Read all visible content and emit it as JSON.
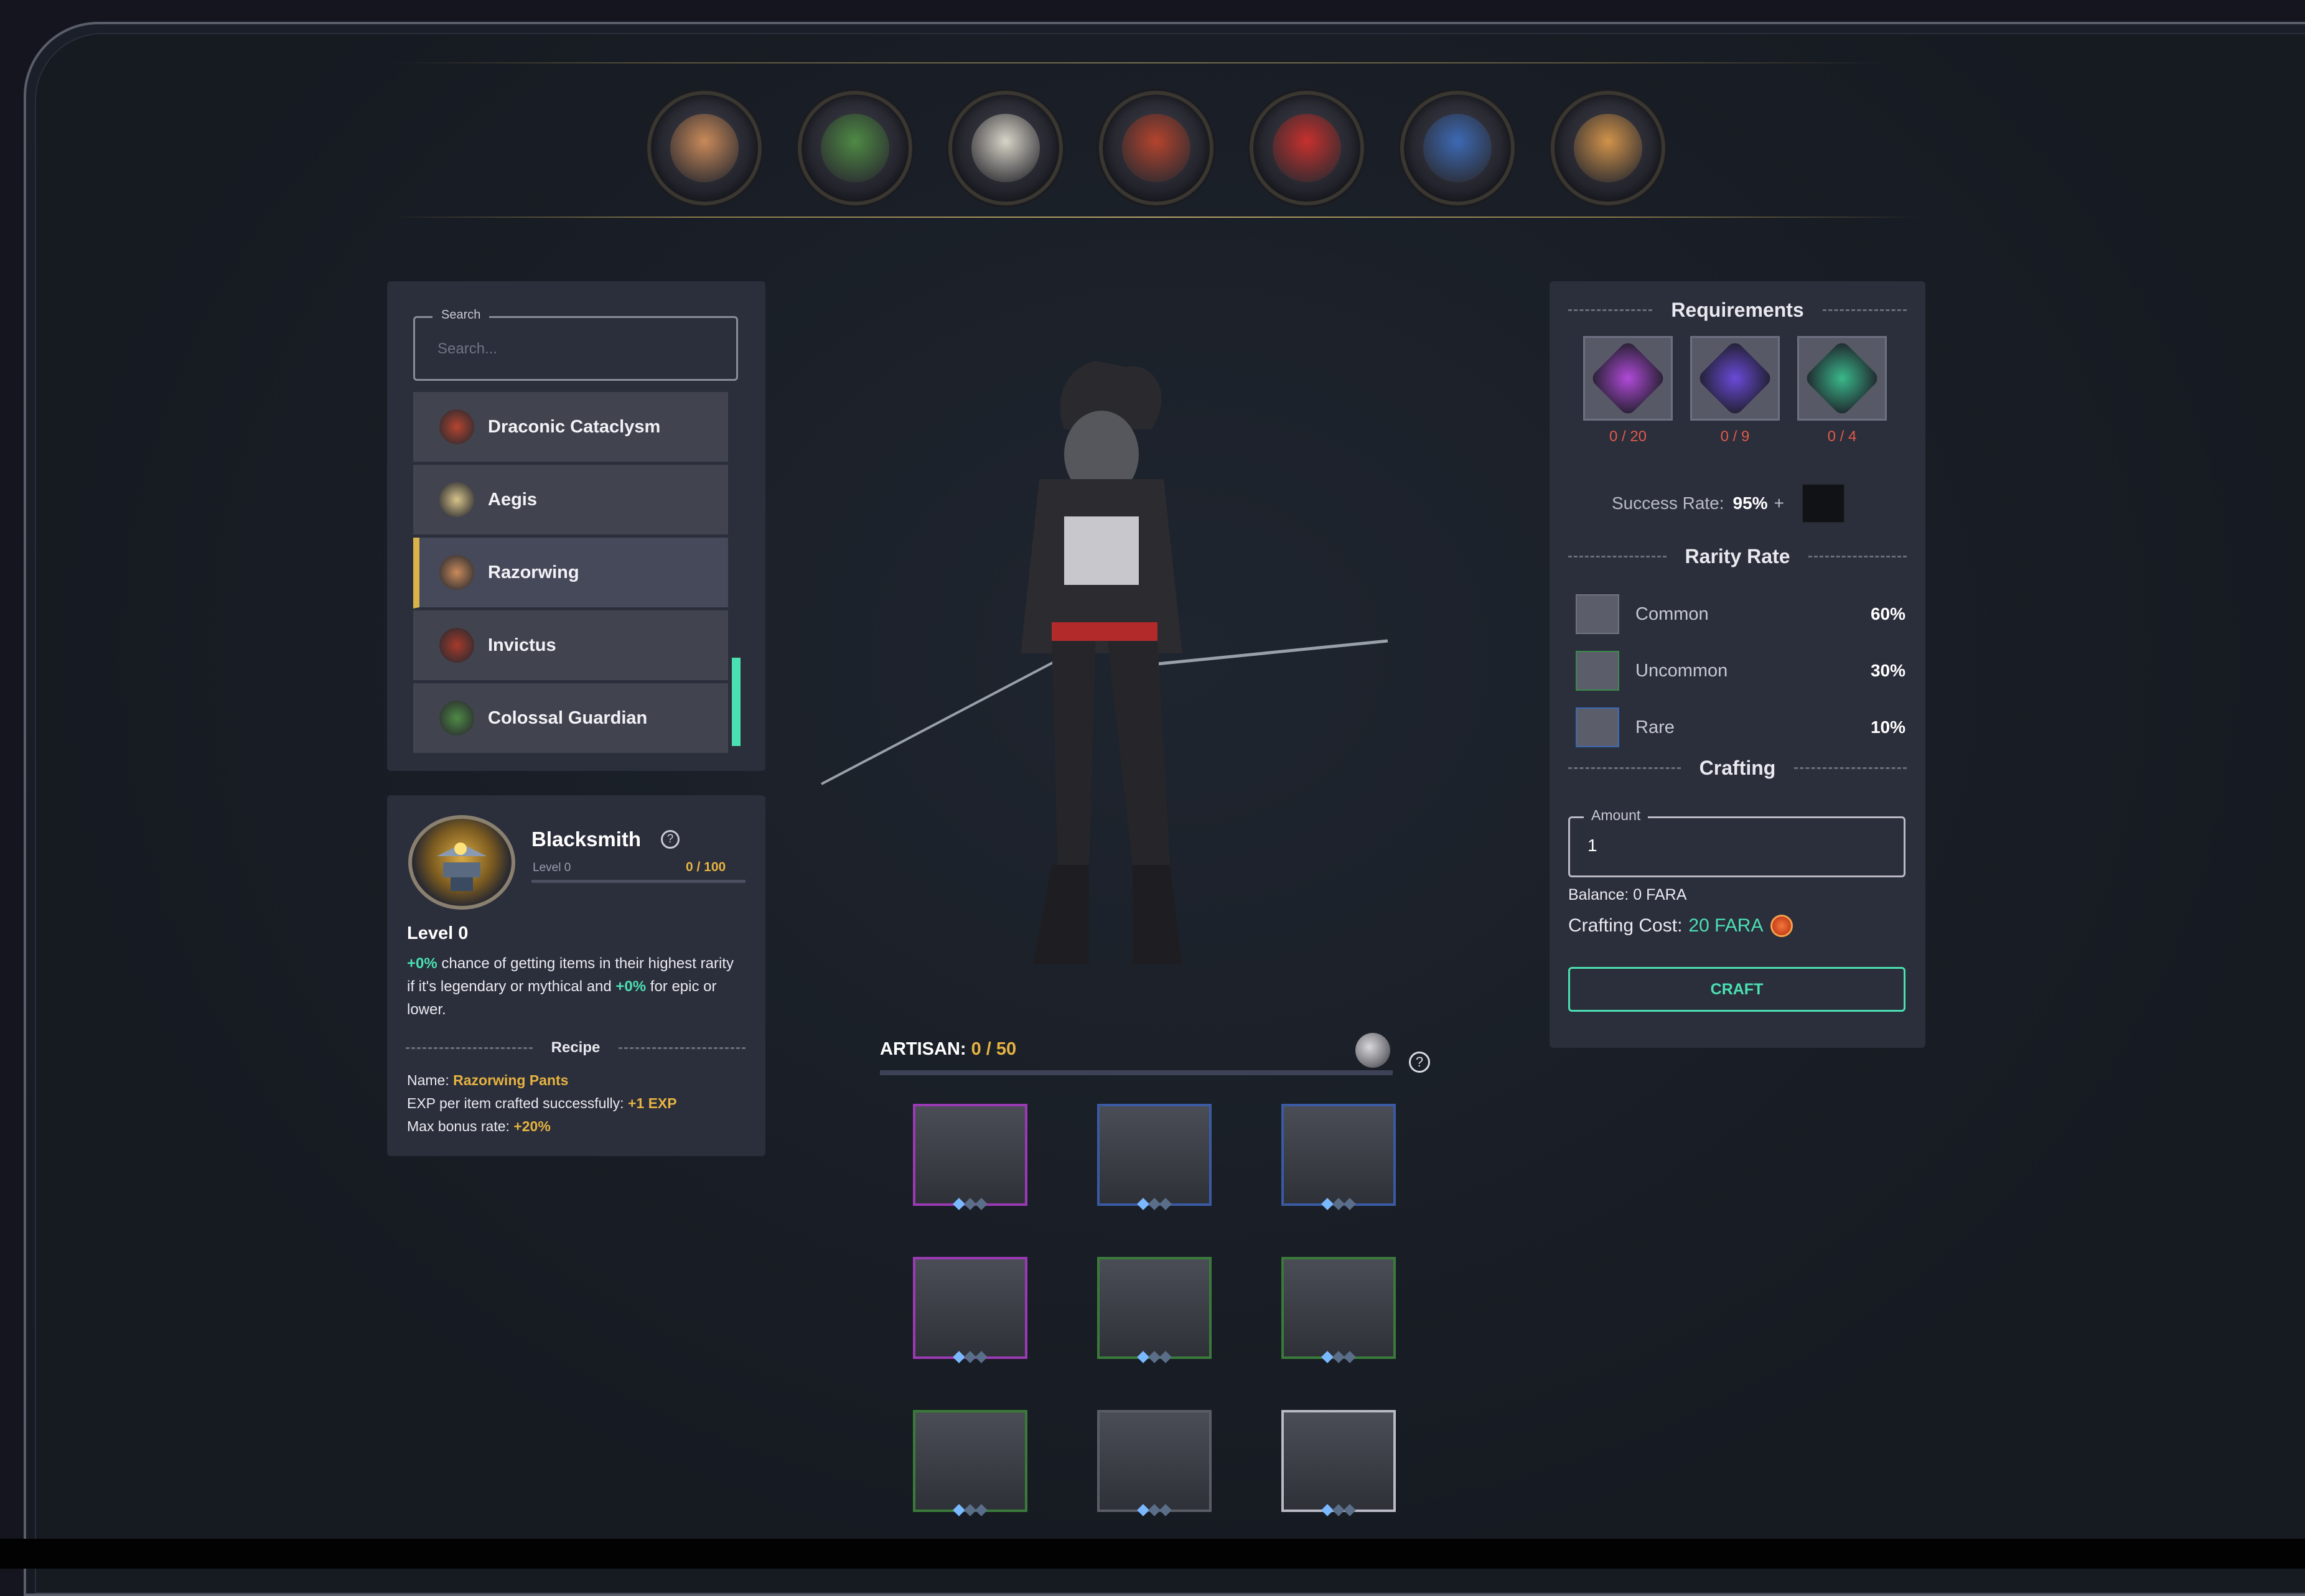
{
  "heroes": [
    {
      "name": "hero-1",
      "face": "#c98a5a"
    },
    {
      "name": "hero-2",
      "face": "#4e8a44"
    },
    {
      "name": "hero-3",
      "face": "#d8d4c8"
    },
    {
      "name": "hero-4",
      "face": "#b4442e"
    },
    {
      "name": "hero-5",
      "face": "#c6312e"
    },
    {
      "name": "hero-6",
      "face": "#3d6ab4"
    },
    {
      "name": "hero-7",
      "face": "#d1934a"
    }
  ],
  "search": {
    "legend": "Search",
    "placeholder": "Search..."
  },
  "hero_list": [
    {
      "label": "Draconic Cataclysm",
      "icon": "#b4442e",
      "active": false
    },
    {
      "label": "Aegis",
      "icon": "#d8c48a",
      "active": false
    },
    {
      "label": "Razorwing",
      "icon": "#c98a5a",
      "active": true
    },
    {
      "label": "Invictus",
      "icon": "#a63a2a",
      "active": false
    },
    {
      "label": "Colossal Guardian",
      "icon": "#4e8a44",
      "active": false
    }
  ],
  "blacksmith": {
    "title": "Blacksmith",
    "help": "?",
    "level_small": "Level 0",
    "exp": "0 / 100",
    "exp_fraction": 0,
    "level_heading": "Level 0",
    "desc_pct1": "+0%",
    "desc_text1": " chance of getting items in their highest rarity if it's legendary or mythical and ",
    "desc_pct2": "+0%",
    "desc_text2": " for epic or lower.",
    "recipe_label": "Recipe",
    "name_label": "Name: ",
    "name_value": "Razorwing Pants",
    "exp_label": "EXP per item crafted successfully: ",
    "exp_value": "+1 EXP",
    "bonus_label": "Max bonus rate: ",
    "bonus_value": "+20%"
  },
  "requirements": {
    "title": "Requirements",
    "items": [
      {
        "icon": "purple-crystal-icon",
        "count": "0 / 20",
        "color": "#b04ad8"
      },
      {
        "icon": "violet-gem-icon",
        "count": "0 / 9",
        "color": "#6a4ad8"
      },
      {
        "icon": "green-rune-icon",
        "count": "0 / 4",
        "color": "#3ab88a"
      }
    ],
    "success_label": "Success Rate:",
    "success_value": "95%",
    "plus": "+"
  },
  "rarity": {
    "title": "Rarity Rate",
    "rows": [
      {
        "name": "Common",
        "pct": "60%",
        "border": "#70737f"
      },
      {
        "name": "Uncommon",
        "pct": "30%",
        "border": "#3a8a4a"
      },
      {
        "name": "Rare",
        "pct": "10%",
        "border": "#3a6ab4"
      }
    ]
  },
  "crafting": {
    "title": "Crafting",
    "amount_legend": "Amount",
    "amount_value": "1",
    "balance": "Balance: 0 FARA",
    "cost_label": "Crafting Cost:",
    "cost_value": "20 FARA",
    "craft_label": "CRAFT"
  },
  "artisan": {
    "label": "ARTISAN: ",
    "value": "0 / 50",
    "help": "?"
  },
  "items": [
    {
      "name": "epic-axe",
      "border": "#9a3ab4",
      "gems": 1
    },
    {
      "name": "rare-shield",
      "border": "#3a5aa4",
      "gems": 1
    },
    {
      "name": "rare-dagger",
      "border": "#3a5aa4",
      "gems": 1
    },
    {
      "name": "epic-crossbow",
      "border": "#9a3ab4",
      "gems": 1
    },
    {
      "name": "uncommon-gloves",
      "border": "#3a7a3a",
      "gems": 1
    },
    {
      "name": "uncommon-hat",
      "border": "#3a7a3a",
      "gems": 1
    },
    {
      "name": "uncommon-coat",
      "border": "#3a7a3a",
      "gems": 1
    },
    {
      "name": "common-boots",
      "border": "#5a5d66",
      "gems": 1
    },
    {
      "name": "selected-pants",
      "border": "#b9bac4",
      "gems": 1
    }
  ]
}
